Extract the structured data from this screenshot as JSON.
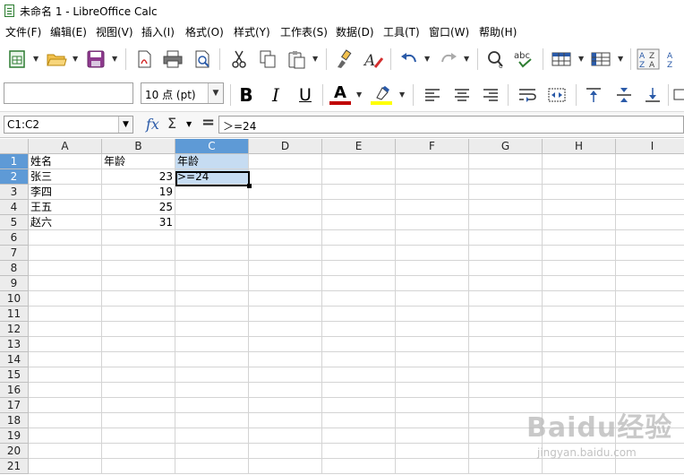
{
  "window": {
    "title": "未命名 1 - LibreOffice Calc"
  },
  "menu": [
    "文件(F)",
    "编辑(E)",
    "视图(V)",
    "插入(I)",
    "格式(O)",
    "样式(Y)",
    "工作表(S)",
    "数据(D)",
    "工具(T)",
    "窗口(W)",
    "帮助(H)"
  ],
  "toolbar": {
    "font_name": "",
    "font_size": "10 点 (pt)",
    "bold_label": "B",
    "italic_label": "I",
    "underline_label": "U",
    "font_color_label": "A",
    "spell_label": "abc",
    "font_color": "#c00000",
    "highlight_color": "#ffff00"
  },
  "formula_bar": {
    "name_box": "C1:C2",
    "content": "＞=24",
    "fx_label": "fx",
    "sum_label": "Σ",
    "equals_label": "="
  },
  "sheet": {
    "columns": [
      "A",
      "B",
      "C",
      "D",
      "E",
      "F",
      "G",
      "H",
      "I"
    ],
    "rows": [
      "1",
      "2",
      "3",
      "4",
      "5",
      "6",
      "7",
      "8",
      "9",
      "10",
      "11",
      "12",
      "13",
      "14",
      "15",
      "16",
      "17",
      "18",
      "19",
      "20",
      "21"
    ],
    "cells": [
      [
        "姓名",
        "年龄",
        "年龄"
      ],
      [
        "张三",
        "23",
        ">=24"
      ],
      [
        "李四",
        "19",
        ""
      ],
      [
        "王五",
        "25",
        ""
      ],
      [
        "赵六",
        "31",
        ""
      ]
    ],
    "selected_column": "C",
    "selected_rows": [
      "1",
      "2"
    ]
  },
  "watermark": {
    "text": "Baidu经验",
    "sub": "jingyan.baidu.com"
  }
}
